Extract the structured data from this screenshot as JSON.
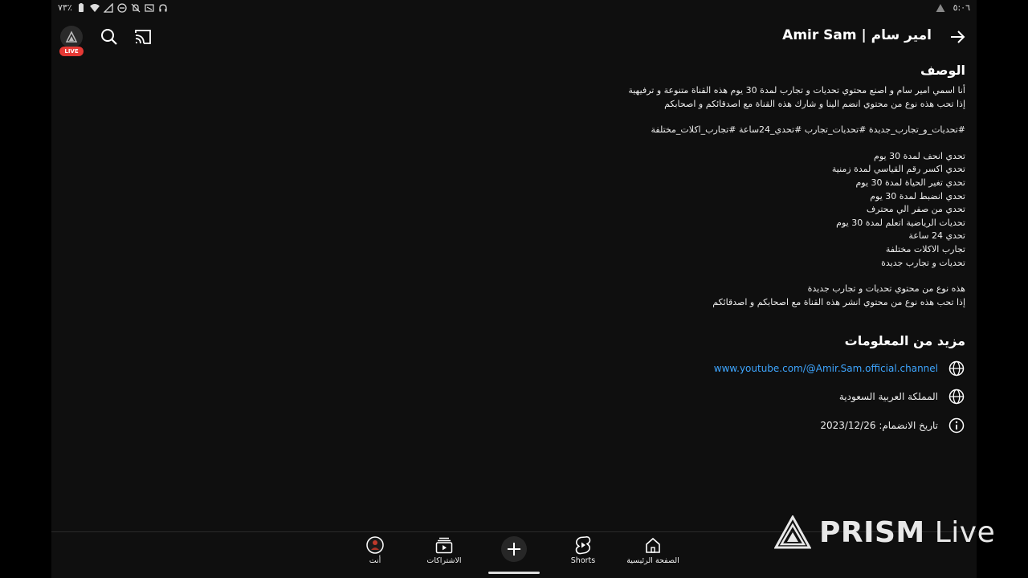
{
  "status_bar": {
    "battery": "٧٣٪",
    "time": "٥:٠٦"
  },
  "header": {
    "live_badge": "LIVE",
    "channel_title": "Amir Sam | امير سام"
  },
  "description": {
    "title": "الوصف",
    "paragraph1": [
      "أنا اسمي امير سام و اصنع محتوي تحديات و تجارب لمدة 30 يوم هذه القناة متنوعة و ترفيهية",
      "إذا تحب هذه نوع من محتوي انضم الينا و شارك هذه القناة مع اصدقائكم و اصحابكم"
    ],
    "hashtags": "#تحديات_و_تجارب_جديدة  #تحديات_تجارب  #تحدي_24ساعة  #تجارب_اكلات_مختلفة",
    "list": [
      "تحدي انحف لمدة 30 يوم",
      "تحدي اكسر رقم القياسي لمدة زمنية",
      "تحدي تغير الحياة لمدة 30 يوم",
      "تحدي انضبط لمدة 30 يوم",
      "تحدي من صفر الي محترف",
      "تحديات الرياضية اتعلم لمدة 30 يوم",
      "تحدي 24 ساعة",
      "تجارب الاكلات مختلفة",
      "تحديات و تجارب جديدة"
    ],
    "paragraph2": [
      "هذه نوع من محتوي تحديات و تجارب جديدة",
      "إذا تحب هذه نوع من محتوي انشر هذه القناة مع اصحابكم و اصدقائكم"
    ]
  },
  "more_info": {
    "title": "مزيد من المعلومات",
    "link": "www.youtube.com/@Amir.Sam.official.channel",
    "country": "المملكة العربية السعودية",
    "joined": "تاريخ الانضمام: 2023/12/26"
  },
  "bottom_nav": {
    "home": "الصفحة الرئيسية",
    "shorts": "Shorts",
    "subscriptions": "الاشتراكات",
    "you": "أنت"
  },
  "watermark": {
    "brand": "PRISM",
    "suffix": " Live"
  }
}
